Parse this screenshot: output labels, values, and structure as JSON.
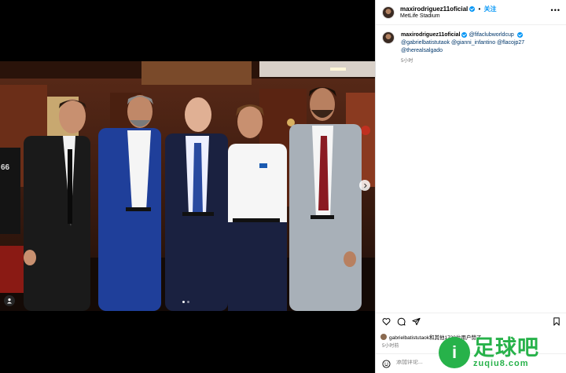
{
  "header": {
    "username": "maxirodriguez11oficial",
    "follow_label": "关注",
    "separator": "•",
    "location": "MetLife Stadium",
    "more_icon": "more-horizontal-icon"
  },
  "caption": {
    "username": "maxirodriguez11oficial",
    "mentions": [
      "@fifaclubworldcup",
      "@gabrielbatistutaok",
      "@gianni_infantino",
      "@flacojp27",
      "@therealsalgado"
    ],
    "time": "5小时"
  },
  "media": {
    "jersey_number": "66",
    "carousel_count": 2,
    "carousel_active": 0
  },
  "likes": {
    "text": "gabrielbatistutaok和其他1730位用户赞了",
    "time": "5小时前"
  },
  "comment": {
    "placeholder": "添加评论..."
  },
  "watermark": {
    "cn": "足球吧",
    "en": "zuqiu8.com",
    "logo_glyph": "i"
  },
  "colors": {
    "accent": "#0095f6",
    "link": "#00376b",
    "watermark_green": "#27b24a"
  }
}
